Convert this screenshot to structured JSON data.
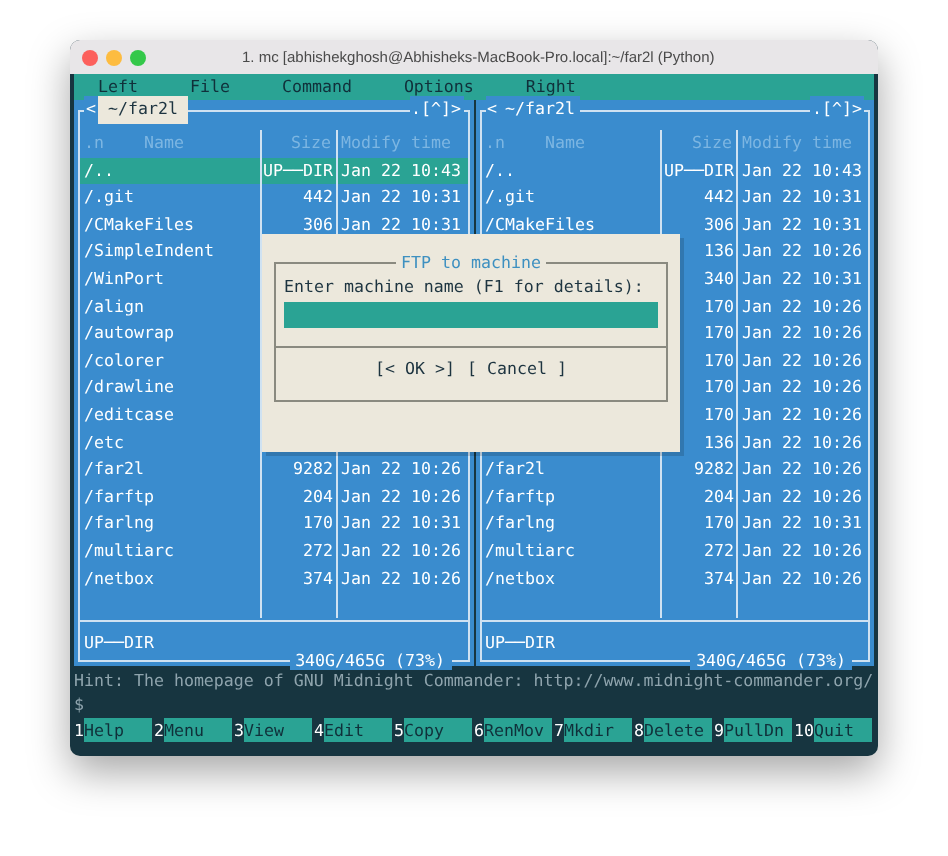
{
  "window": {
    "title": "1. mc [abhishekghosh@Abhisheks-MacBook-Pro.local]:~/far2l (Python)"
  },
  "menu": [
    "Left",
    "File",
    "Command",
    "Options",
    "Right"
  ],
  "panels": [
    {
      "arrow": "<",
      "path": "~/far2l",
      "active": true,
      "corner": ".[^]>",
      "columns": [
        ".n",
        "Name",
        "Size",
        "Modify time"
      ],
      "rows": [
        {
          "name": "/..",
          "size": "UP──DIR",
          "time": "Jan 22 10:43",
          "selected": true
        },
        {
          "name": "/.git",
          "size": "442",
          "time": "Jan 22 10:31",
          "selected": false
        },
        {
          "name": "/CMakeFiles",
          "size": "306",
          "time": "Jan 22 10:31",
          "selected": false
        },
        {
          "name": "/SimpleIndent",
          "selected": false
        },
        {
          "name": "/WinPort",
          "selected": false
        },
        {
          "name": "/align",
          "selected": false
        },
        {
          "name": "/autowrap",
          "selected": false
        },
        {
          "name": "/colorer",
          "selected": false
        },
        {
          "name": "/drawline",
          "selected": false
        },
        {
          "name": "/editcase",
          "selected": false
        },
        {
          "name": "/etc",
          "selected": false
        },
        {
          "name": "/far2l",
          "size": "9282",
          "time": "Jan 22 10:26",
          "selected": false
        },
        {
          "name": "/farftp",
          "size": "204",
          "time": "Jan 22 10:26",
          "selected": false
        },
        {
          "name": "/farlng",
          "size": "170",
          "time": "Jan 22 10:31",
          "selected": false
        },
        {
          "name": "/multiarc",
          "size": "272",
          "time": "Jan 22 10:26",
          "selected": false
        },
        {
          "name": "/netbox",
          "size": "374",
          "time": "Jan 22 10:26",
          "selected": false
        }
      ],
      "status": "UP──DIR",
      "disk": "340G/465G (73%)"
    },
    {
      "arrow": "<",
      "path": "~/far2l",
      "active": false,
      "corner": ".[^]>",
      "columns": [
        ".n",
        "Name",
        "Size",
        "Modify time"
      ],
      "rows": [
        {
          "name": "/..",
          "size": "UP──DIR",
          "time": "Jan 22 10:43",
          "selected": false
        },
        {
          "name": "/.git",
          "size": "442",
          "time": "Jan 22 10:31",
          "selected": false
        },
        {
          "name": "/CMakeFiles",
          "size": "306",
          "time": "Jan 22 10:31",
          "selected": false
        },
        {
          "size": "136",
          "time": "Jan 22 10:26",
          "selected": false
        },
        {
          "size": "340",
          "time": "Jan 22 10:31",
          "selected": false
        },
        {
          "size": "170",
          "time": "Jan 22 10:26",
          "selected": false
        },
        {
          "size": "170",
          "time": "Jan 22 10:26",
          "selected": false
        },
        {
          "size": "170",
          "time": "Jan 22 10:26",
          "selected": false
        },
        {
          "size": "170",
          "time": "Jan 22 10:26",
          "selected": false
        },
        {
          "size": "170",
          "time": "Jan 22 10:26",
          "selected": false
        },
        {
          "size": "136",
          "time": "Jan 22 10:26",
          "selected": false
        },
        {
          "name": "/far2l",
          "size": "9282",
          "time": "Jan 22 10:26",
          "selected": false
        },
        {
          "name": "/farftp",
          "size": "204",
          "time": "Jan 22 10:26",
          "selected": false
        },
        {
          "name": "/farlng",
          "size": "170",
          "time": "Jan 22 10:31",
          "selected": false
        },
        {
          "name": "/multiarc",
          "size": "272",
          "time": "Jan 22 10:26",
          "selected": false
        },
        {
          "name": "/netbox",
          "size": "374",
          "time": "Jan 22 10:26",
          "selected": false
        }
      ],
      "status": "UP──DIR",
      "disk": "340G/465G (73%)"
    }
  ],
  "dialog": {
    "title": "FTP to machine",
    "label": "Enter machine name (F1 for details):",
    "buttons": [
      "[< OK >]",
      "[ Cancel ]"
    ]
  },
  "hint": "Hint: The homepage of GNU Midnight Commander: http://www.midnight-commander.org/",
  "prompt": "$",
  "fkeys": [
    {
      "num": "1",
      "label": "Help"
    },
    {
      "num": "2",
      "label": "Menu"
    },
    {
      "num": "3",
      "label": "View"
    },
    {
      "num": "4",
      "label": "Edit"
    },
    {
      "num": "5",
      "label": "Copy"
    },
    {
      "num": "6",
      "label": "RenMov"
    },
    {
      "num": "7",
      "label": "Mkdir"
    },
    {
      "num": "8",
      "label": "Delete"
    },
    {
      "num": "9",
      "label": "PullDn"
    },
    {
      "num": "10",
      "label": "Quit"
    }
  ]
}
